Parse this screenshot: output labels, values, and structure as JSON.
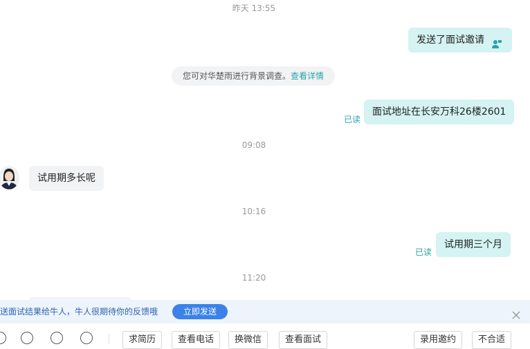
{
  "timestamps": {
    "t1": "昨天 13:55",
    "t2": "09:08",
    "t3": "10:16",
    "t4": "11:20"
  },
  "messages": {
    "invite": "发送了面试邀请",
    "notice_text": "您可对华楚雨进行背景调查。",
    "notice_link": "查看详情",
    "address": "面试地址在长安万科26楼2601",
    "question": "试用期多长呢",
    "answer": "试用期三个月",
    "read_label": "已读"
  },
  "banner": {
    "text": "送面试结果给牛人，牛人很期待你的反馈哦",
    "button": "立即发送"
  },
  "toolbar": {
    "buttons": [
      "求简历",
      "查看电话",
      "换微信",
      "查看面试",
      "录用邀约",
      "不合适"
    ]
  },
  "colors": {
    "accent": "#2aa3a8",
    "bubble_me": "#d4f3f2",
    "banner_button": "#3b82e8"
  }
}
